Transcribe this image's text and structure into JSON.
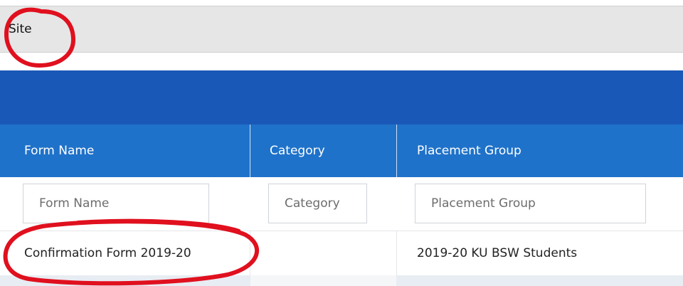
{
  "site": {
    "label": "Site"
  },
  "table": {
    "columns": [
      {
        "header": "Form Name",
        "filter_placeholder": "Form Name"
      },
      {
        "header": "Category",
        "filter_placeholder": "Category"
      },
      {
        "header": "Placement Group",
        "filter_placeholder": "Placement Group"
      }
    ],
    "rows": [
      {
        "form_name": "Confirmation Form 2019-20",
        "category": "",
        "placement_group": "2019-20 KU BSW Students"
      }
    ]
  },
  "colors": {
    "banner": "#1a58b8",
    "header": "#1f72c9",
    "annotation": "#e0101e"
  }
}
